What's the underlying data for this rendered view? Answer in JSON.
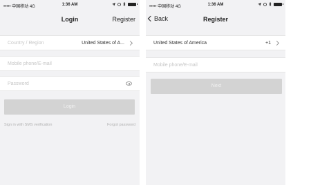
{
  "status": {
    "carrier": "••••• 中国移动 4G",
    "time": "1:36 AM"
  },
  "login": {
    "title": "Login",
    "register_link": "Register",
    "country_label": "Country / Region",
    "country_value": "United States of A...",
    "mobile_placeholder": "Mobile phone/E-mail",
    "password_placeholder": "Password",
    "login_button": "Login",
    "sms_link": "Sign in with SMS verification",
    "forgot_link": "Forgot password"
  },
  "register": {
    "back_label": "Back",
    "title": "Register",
    "country_value": "United States of America",
    "country_code": "+1",
    "mobile_placeholder": "Mobile phone/E-mail",
    "next_button": "Next"
  }
}
